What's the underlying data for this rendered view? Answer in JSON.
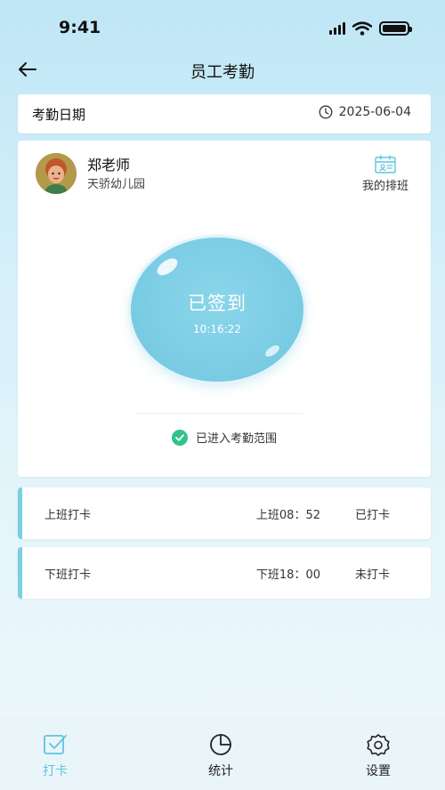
{
  "status_bar": {
    "time": "9:41",
    "battery_level": 1.0
  },
  "header": {
    "title": "员工考勤"
  },
  "date_bar": {
    "label": "考勤日期",
    "value": "2025-06-04"
  },
  "user": {
    "name": "郑老师",
    "school": "天骄幼儿园",
    "schedule_label": "我的排班"
  },
  "sign": {
    "status": "已签到",
    "time": "10:16:22"
  },
  "range": {
    "text": "已进入考勤范围"
  },
  "records": [
    {
      "label": "上班打卡",
      "time": "上班08：52",
      "status": "已打卡"
    },
    {
      "label": "下班打卡",
      "time": "下班18：00",
      "status": "未打卡"
    }
  ],
  "tabs": [
    {
      "label": "打卡",
      "active": true,
      "icon": "check-square-icon"
    },
    {
      "label": "统计",
      "active": false,
      "icon": "pie-chart-icon"
    },
    {
      "label": "设置",
      "active": false,
      "icon": "gear-icon"
    }
  ],
  "colors": {
    "accent": "#7acfe3",
    "active_tab": "#5ec5de",
    "success": "#2fc38a"
  }
}
